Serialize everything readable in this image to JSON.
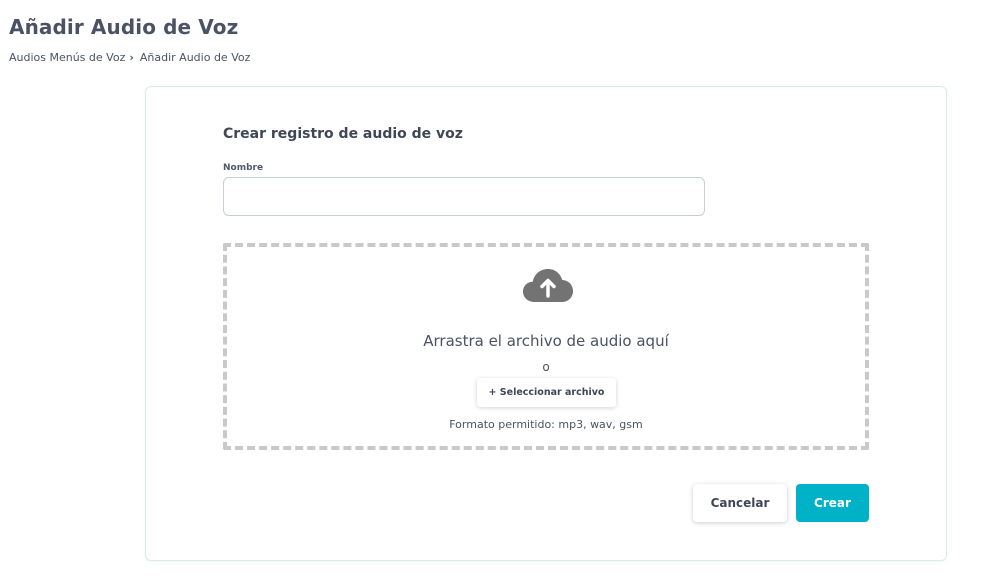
{
  "header": {
    "title": "Añadir Audio de Voz"
  },
  "breadcrumb": {
    "items": [
      {
        "label": "Audios Menús de Voz"
      },
      {
        "label": "Añadir Audio de Voz"
      }
    ],
    "separator": "›"
  },
  "form": {
    "title": "Crear registro de audio de voz",
    "name_label": "Nombre",
    "name_value": "",
    "name_placeholder": ""
  },
  "dropzone": {
    "icon": "cloud-upload-icon",
    "drag_text": "Arrastra el archivo de audio aquí",
    "or_text": "o",
    "select_label": "+ Seleccionar archivo",
    "format_text": "Formato permitido: mp3, wav, gsm"
  },
  "actions": {
    "cancel_label": "Cancelar",
    "create_label": "Crear"
  },
  "colors": {
    "accent": "#00b2c8",
    "icon_gray": "#737373",
    "dash_border": "#c9c9c9"
  }
}
